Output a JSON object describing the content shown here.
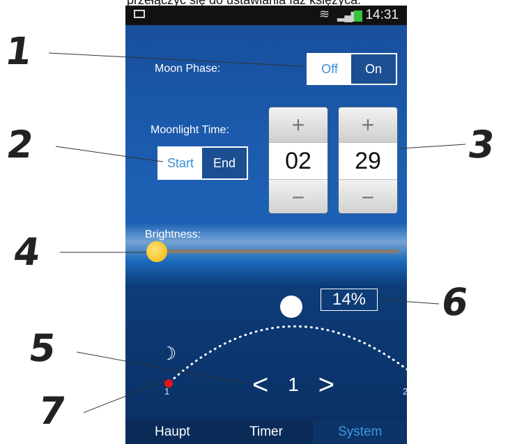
{
  "caption": "przełączyć się do ustawiania faz księżyca.",
  "status_bar": {
    "time": "14:31",
    "icons": [
      "image-icon",
      "wifi-icon",
      "signal-icon",
      "battery-icon"
    ]
  },
  "moon_phase": {
    "label": "Moon Phase:",
    "options": [
      "Off",
      "On"
    ],
    "selected": "Off"
  },
  "moonlight_time": {
    "label": "Moonlight Time:",
    "options": [
      "Start",
      "End"
    ],
    "selected": "Start",
    "hour": "02",
    "minute": "29",
    "plus": "+",
    "minus": "−"
  },
  "brightness": {
    "label": "Brightness:",
    "value": 0.0
  },
  "percent_display": "14%",
  "day_selector": {
    "prev": "<",
    "value": "1",
    "next": ">",
    "start_label": "1",
    "end_label": "2"
  },
  "bottom_nav": {
    "tabs": [
      "Haupt",
      "Timer",
      "System"
    ],
    "selected": "System"
  },
  "callouts": [
    "1",
    "2",
    "3",
    "4",
    "5",
    "6",
    "7"
  ],
  "colors": {
    "accent": "#3a8fd6",
    "marker": "#e8141c",
    "sun": "#f2b400"
  }
}
